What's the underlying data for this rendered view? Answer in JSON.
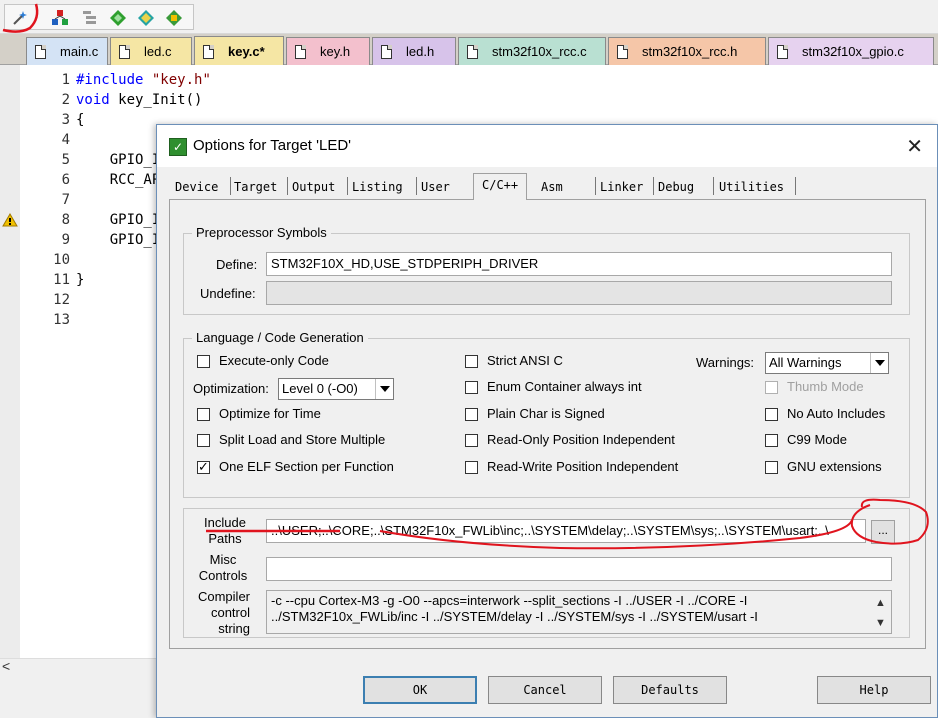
{
  "toolbar": {
    "icons": [
      "magic-wand-icon",
      "target-options-icon",
      "component-icon",
      "diamond-icon",
      "pack-installer-icon",
      "pack-manager-icon"
    ]
  },
  "tabs": [
    {
      "label": "main.c",
      "color": "#d4e3f5",
      "active": false
    },
    {
      "label": "led.c",
      "color": "#f5e6a4",
      "active": false
    },
    {
      "label": "key.c*",
      "color": "#f5e6a4",
      "active": true
    },
    {
      "label": "key.h",
      "color": "#f3c0cd",
      "active": false
    },
    {
      "label": "led.h",
      "color": "#d7c3ea",
      "active": false
    },
    {
      "label": "stm32f10x_rcc.c",
      "color": "#b9e0d2",
      "active": false
    },
    {
      "label": "stm32f10x_rcc.h",
      "color": "#f5c6a8",
      "active": false
    },
    {
      "label": "stm32f10x_gpio.c",
      "color": "#e6d2ef",
      "active": false
    }
  ],
  "editor": {
    "lines": [
      {
        "n": "1",
        "kw": "#include",
        "str": " \"key.h\"",
        "rest": ""
      },
      {
        "n": "2",
        "kw": "void",
        "str": "",
        "rest": " key_Init()"
      },
      {
        "n": "3",
        "kw": "",
        "str": "",
        "rest": "{"
      },
      {
        "n": "4",
        "kw": "",
        "str": "",
        "rest": ""
      },
      {
        "n": "5",
        "kw": "",
        "str": "",
        "rest": "    GPIO_I"
      },
      {
        "n": "6",
        "kw": "",
        "str": "",
        "rest": "    RCC_AP"
      },
      {
        "n": "7",
        "kw": "",
        "str": "",
        "rest": ""
      },
      {
        "n": "8",
        "kw": "",
        "str": "",
        "rest": "    GPIO_I"
      },
      {
        "n": "9",
        "kw": "",
        "str": "",
        "rest": "    GPIO_I"
      },
      {
        "n": "10",
        "kw": "",
        "str": "",
        "rest": ""
      },
      {
        "n": "11",
        "kw": "",
        "str": "",
        "rest": "}"
      },
      {
        "n": "12",
        "kw": "",
        "str": "",
        "rest": ""
      },
      {
        "n": "13",
        "kw": "",
        "str": "",
        "rest": ""
      }
    ]
  },
  "dialog": {
    "title": "Options for Target 'LED'",
    "tabs": [
      "Device",
      "Target",
      "Output",
      "Listing",
      "User",
      "C/C++",
      "Asm",
      "Linker",
      "Debug",
      "Utilities"
    ],
    "active_tab": "C/C++",
    "preprocessor": {
      "group_title": "Preprocessor Symbols",
      "define_label": "Define:",
      "define_value": "STM32F10X_HD,USE_STDPERIPH_DRIVER",
      "undefine_label": "Undefine:",
      "undefine_value": ""
    },
    "language": {
      "group_title": "Language / Code Generation",
      "execute_only": {
        "label": "Execute-only Code",
        "checked": false
      },
      "optimization_label": "Optimization:",
      "optimization_value": "Level 0 (-O0)",
      "optimize_time": {
        "label": "Optimize for Time",
        "checked": false
      },
      "split_load": {
        "label": "Split Load and Store Multiple",
        "checked": false
      },
      "one_elf": {
        "label": "One ELF Section per Function",
        "checked": true
      },
      "strict_ansi": {
        "label": "Strict ANSI C",
        "checked": false
      },
      "enum_container": {
        "label": "Enum Container always int",
        "checked": false
      },
      "plain_char": {
        "label": "Plain Char is Signed",
        "checked": false
      },
      "ro_pos_indep": {
        "label": "Read-Only Position Independent",
        "checked": false
      },
      "rw_pos_indep": {
        "label": "Read-Write Position Independent",
        "checked": false
      },
      "warnings_label": "Warnings:",
      "warnings_value": "All Warnings",
      "thumb_mode": {
        "label": "Thumb Mode",
        "checked": false,
        "disabled": true
      },
      "no_auto_includes": {
        "label": "No Auto Includes",
        "checked": false
      },
      "c99_mode": {
        "label": "C99 Mode",
        "checked": false
      },
      "gnu_ext": {
        "label": "GNU extensions",
        "checked": false
      }
    },
    "include": {
      "label_line1": "Include",
      "label_line2": "Paths",
      "value": "..\\USER;..\\CORE;..\\STM32F10x_FWLib\\inc;..\\SYSTEM\\delay;..\\SYSTEM\\sys;..\\SYSTEM\\usart;..\\",
      "browse_label": "..."
    },
    "misc": {
      "label_line1": "Misc",
      "label_line2": "Controls",
      "value": ""
    },
    "compiler": {
      "label_line1": "Compiler",
      "label_line2": "control",
      "label_line3": "string",
      "line1": "-c --cpu Cortex-M3 -g -O0 --apcs=interwork --split_sections -I ../USER -I ../CORE -I",
      "line2": "../STM32F10x_FWLib/inc -I ../SYSTEM/delay -I ../SYSTEM/sys -I ../SYSTEM/usart -I"
    },
    "buttons": {
      "ok": "OK",
      "cancel": "Cancel",
      "defaults": "Defaults",
      "help": "Help"
    }
  },
  "colors": {
    "annotation": "#e0141e",
    "keyword": "#0000ff",
    "string": "#800000"
  }
}
